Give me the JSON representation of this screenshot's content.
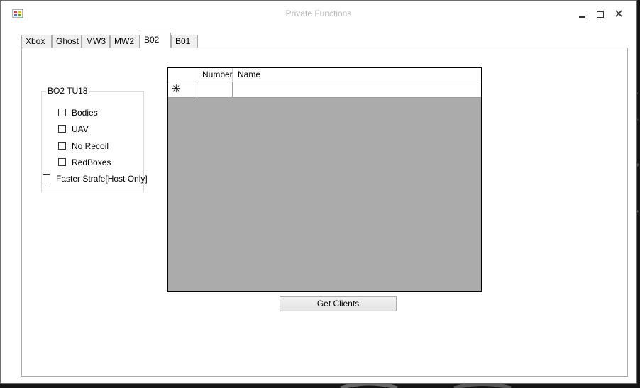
{
  "window": {
    "title": "Private Functions"
  },
  "tabs": [
    {
      "label": "Xbox",
      "active": false
    },
    {
      "label": "Ghost",
      "active": false
    },
    {
      "label": "MW3",
      "active": false
    },
    {
      "label": "MW2",
      "active": false
    },
    {
      "label": "B02",
      "active": true
    },
    {
      "label": "B01",
      "active": false
    }
  ],
  "group": {
    "title": "BO2 TU18",
    "checkboxes": [
      {
        "label": "Bodies",
        "checked": false
      },
      {
        "label": "UAV",
        "checked": false
      },
      {
        "label": "No Recoil",
        "checked": false
      },
      {
        "label": "RedBoxes",
        "checked": false
      }
    ]
  },
  "faster_strafe": {
    "label": "Faster Strafe[Host Only]",
    "checked": false
  },
  "grid": {
    "columns": [
      "Number",
      "Name"
    ],
    "new_row_marker": "✳"
  },
  "get_clients_button": {
    "label": "Get Clients"
  },
  "colors": {
    "grid_empty": "#ababab",
    "title_text": "#b9b9b9"
  },
  "icons": {
    "app": "app-window-icon",
    "minimize": "minimize-icon",
    "maximize": "maximize-icon",
    "close": "close-icon"
  }
}
